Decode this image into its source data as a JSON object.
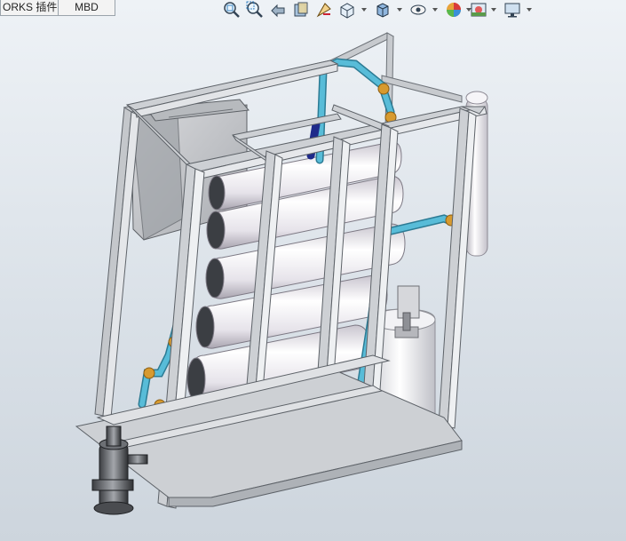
{
  "tabs": [
    {
      "label": "ORKS 插件"
    },
    {
      "label": "MBD"
    }
  ],
  "toolbar": {
    "icons": [
      "zoom-to-fit-icon",
      "zoom-to-area-icon",
      "previous-view-icon",
      "section-view-icon",
      "dynamic-annotation-icon",
      "view-orientation-icon",
      "display-style-icon",
      "hide-show-items-icon",
      "edit-appearance-icon",
      "apply-scene-icon",
      "view-settings-icon"
    ]
  },
  "colors": {
    "frame": "#c9ccd0",
    "pipe": "#4fb3d0",
    "fitting": "#d9a23a",
    "vessel": "#ece9f0",
    "background": "#e4eaf0"
  }
}
